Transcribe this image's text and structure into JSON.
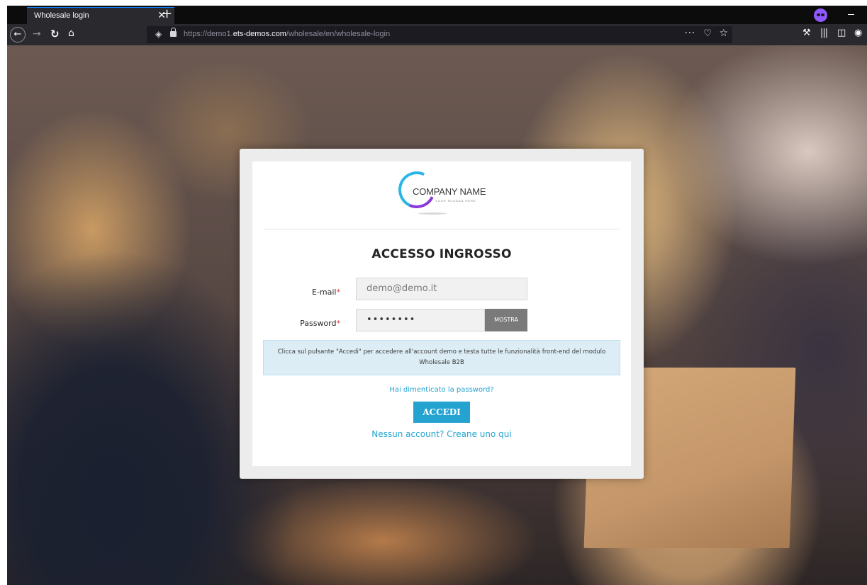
{
  "browser": {
    "tab_title": "Wholesale login",
    "tab_close": "✕",
    "new_tab": "+",
    "url": {
      "prefix": "https://demo1.",
      "domain": "ets-demos.com",
      "path": "/wholesale/en/wholesale-login"
    },
    "page_actions": "···",
    "icons": [
      "private-browsing-icon",
      "back-icon",
      "forward-icon",
      "reload-icon",
      "home-icon",
      "shield-icon",
      "lock-icon",
      "pocket-icon",
      "bookmark-star-icon",
      "tools-icon",
      "library-icon",
      "sidebar-icon",
      "account-icon"
    ]
  },
  "login": {
    "logo": {
      "name": "COMPANY NAME",
      "slogan": "YOUR SLOGAN HERE"
    },
    "title": "ACCESSO INGROSSO",
    "email_label": "E-mail",
    "email_value": "demo@demo.it",
    "password_label": "Password",
    "password_value": "••••••••",
    "required_mark": "*",
    "show_label": "MOSTRA",
    "info_text": "Clicca sul pulsante \"Accedi\" per accedere all'account demo e testa tutte le funzionalità front-end del modulo Wholesale B2B",
    "forgot_password": "Hai dimenticato la password?",
    "submit_label": "ACCEDI",
    "create_account": "Nessun account? Creane uno qui"
  },
  "colors": {
    "accent": "#24a3d1",
    "alert_bg": "#dcedf5",
    "required": "#d43a3a",
    "show_button": "#7a7a7a"
  }
}
